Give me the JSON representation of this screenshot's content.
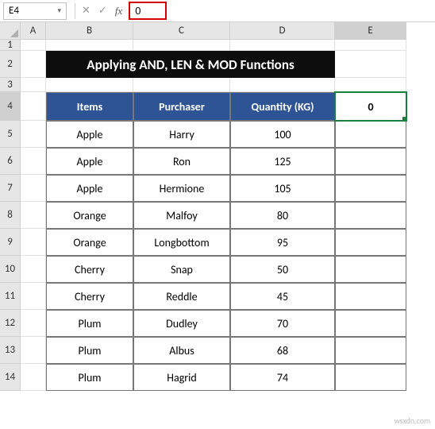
{
  "formula_bar": {
    "cell_ref": "E4",
    "formula": "0"
  },
  "columns": [
    "A",
    "B",
    "C",
    "D",
    "E"
  ],
  "active_col": "E",
  "active_row": 4,
  "rows": [
    1,
    2,
    3,
    4,
    5,
    6,
    7,
    8,
    9,
    10,
    11,
    12,
    13,
    14
  ],
  "title": "Applying AND, LEN & MOD Functions",
  "headers": {
    "items": "Items",
    "purchaser": "Purchaser",
    "quantity": "Quantity (KG)",
    "extra": "0"
  },
  "chart_data": {
    "type": "table",
    "columns": [
      "Items",
      "Purchaser",
      "Quantity (KG)"
    ],
    "rows": [
      {
        "item": "Apple",
        "purchaser": "Harry",
        "qty": 100
      },
      {
        "item": "Apple",
        "purchaser": "Ron",
        "qty": 125
      },
      {
        "item": "Apple",
        "purchaser": "Hermione",
        "qty": 105
      },
      {
        "item": "Orange",
        "purchaser": "Malfoy",
        "qty": 80
      },
      {
        "item": "Orange",
        "purchaser": "Longbottom",
        "qty": 95
      },
      {
        "item": "Cherry",
        "purchaser": "Snap",
        "qty": 50
      },
      {
        "item": "Cherry",
        "purchaser": "Reddle",
        "qty": 45
      },
      {
        "item": "Plum",
        "purchaser": "Dudley",
        "qty": 70
      },
      {
        "item": "Plum",
        "purchaser": "Albus",
        "qty": 68
      },
      {
        "item": "Plum",
        "purchaser": "Hagrid",
        "qty": 74
      }
    ]
  },
  "watermark": "wsxdn.com"
}
